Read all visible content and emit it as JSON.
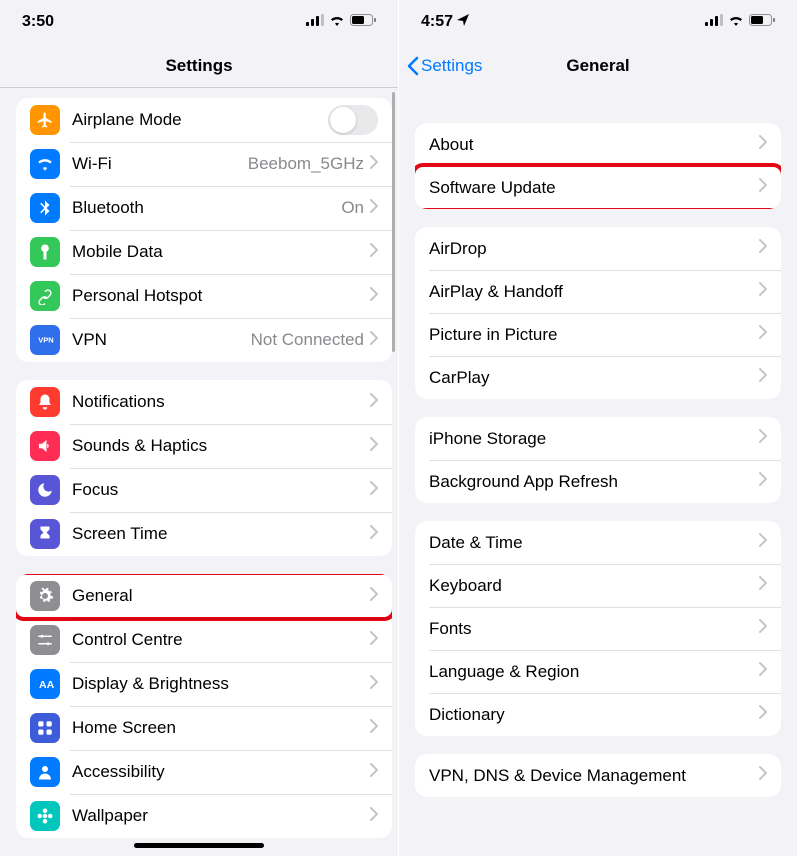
{
  "left": {
    "status": {
      "time": "3:50"
    },
    "nav": {
      "title": "Settings"
    },
    "groups": [
      {
        "rows": [
          {
            "icon": "airplane",
            "iconClass": "c-orange",
            "label": "Airplane Mode",
            "toggle": true,
            "value": ""
          },
          {
            "icon": "wifi",
            "iconClass": "c-blue",
            "label": "Wi-Fi",
            "value": "Beebom_5GHz",
            "chevron": true
          },
          {
            "icon": "bluetooth",
            "iconClass": "c-blue",
            "label": "Bluetooth",
            "value": "On",
            "chevron": true
          },
          {
            "icon": "antenna",
            "iconClass": "c-green",
            "label": "Mobile Data",
            "value": "",
            "chevron": true
          },
          {
            "icon": "link",
            "iconClass": "c-green2",
            "label": "Personal Hotspot",
            "value": "",
            "chevron": true
          },
          {
            "icon": "vpn",
            "iconClass": "c-bluebox",
            "label": "VPN",
            "value": "Not Connected",
            "chevron": true
          }
        ]
      },
      {
        "rows": [
          {
            "icon": "bell",
            "iconClass": "c-red",
            "label": "Notifications",
            "chevron": true
          },
          {
            "icon": "speaker",
            "iconClass": "c-pink",
            "label": "Sounds & Haptics",
            "chevron": true
          },
          {
            "icon": "moon",
            "iconClass": "c-indigo",
            "label": "Focus",
            "chevron": true
          },
          {
            "icon": "hourglass",
            "iconClass": "c-indigo2",
            "label": "Screen Time",
            "chevron": true
          }
        ]
      },
      {
        "rows": [
          {
            "icon": "gear",
            "iconClass": "c-gray",
            "label": "General",
            "chevron": true,
            "highlighted": true
          },
          {
            "icon": "sliders",
            "iconClass": "c-gray2",
            "label": "Control Centre",
            "chevron": true
          },
          {
            "icon": "textsize",
            "iconClass": "c-bluetxt",
            "label": "Display & Brightness",
            "chevron": true
          },
          {
            "icon": "grid",
            "iconClass": "c-bluehome",
            "label": "Home Screen",
            "chevron": true
          },
          {
            "icon": "person",
            "iconClass": "c-blue2",
            "label": "Accessibility",
            "chevron": true
          },
          {
            "icon": "flower",
            "iconClass": "c-cyan",
            "label": "Wallpaper",
            "chevron": true
          }
        ]
      }
    ]
  },
  "right": {
    "status": {
      "time": "4:57"
    },
    "nav": {
      "back": "Settings",
      "title": "General"
    },
    "groups": [
      {
        "rows": [
          {
            "label": "About",
            "chevron": true
          },
          {
            "label": "Software Update",
            "chevron": true,
            "highlighted": true
          }
        ]
      },
      {
        "rows": [
          {
            "label": "AirDrop",
            "chevron": true
          },
          {
            "label": "AirPlay & Handoff",
            "chevron": true
          },
          {
            "label": "Picture in Picture",
            "chevron": true
          },
          {
            "label": "CarPlay",
            "chevron": true
          }
        ]
      },
      {
        "rows": [
          {
            "label": "iPhone Storage",
            "chevron": true
          },
          {
            "label": "Background App Refresh",
            "chevron": true
          }
        ]
      },
      {
        "rows": [
          {
            "label": "Date & Time",
            "chevron": true
          },
          {
            "label": "Keyboard",
            "chevron": true
          },
          {
            "label": "Fonts",
            "chevron": true
          },
          {
            "label": "Language & Region",
            "chevron": true
          },
          {
            "label": "Dictionary",
            "chevron": true
          }
        ]
      },
      {
        "rows": [
          {
            "label": "VPN, DNS & Device Management",
            "chevron": true
          }
        ]
      }
    ]
  }
}
